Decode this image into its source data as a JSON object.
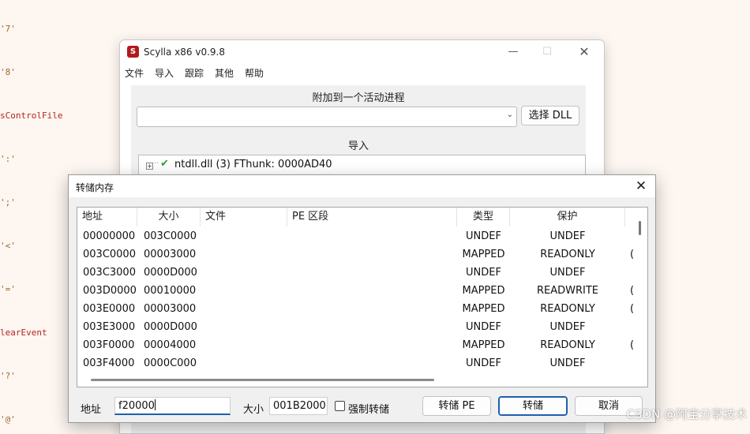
{
  "background_code": {
    "lines": [
      "'7'",
      "'8'",
      "sControlFile",
      "':'",
      "';'",
      "'<'",
      "'='",
      "learEvent",
      "'?'",
      "'@'"
    ]
  },
  "main_window": {
    "title": "Scylla x86 v0.9.8",
    "icon_letter": "S",
    "controls": {
      "minimize": "—",
      "maximize": "☐",
      "close": "✕"
    },
    "menu": [
      "文件",
      "导入",
      "跟踪",
      "其他",
      "帮助"
    ],
    "attach_group_title": "附加到一个活动进程",
    "process_combo_value": "",
    "pick_dll_label": "选择 DLL",
    "imports_group_title": "导入",
    "tree_item": {
      "expander": "+",
      "label": "ntdll.dll (3) FThunk: 0000AD40",
      "status_icon": "check-icon"
    }
  },
  "dump_dialog": {
    "title": "转储内存",
    "close_glyph": "✕",
    "columns": [
      "地址",
      "大小",
      "文件",
      "PE 区段",
      "类型",
      "保护"
    ],
    "rows": [
      {
        "address": "00000000",
        "size": "003C0000",
        "file": "",
        "pe_section": "",
        "type": "UNDEF",
        "protect": "UNDEF",
        "extra": ""
      },
      {
        "address": "003C0000",
        "size": "00003000",
        "file": "",
        "pe_section": "",
        "type": "MAPPED",
        "protect": "READONLY",
        "extra": "("
      },
      {
        "address": "003C3000",
        "size": "0000D000",
        "file": "",
        "pe_section": "",
        "type": "UNDEF",
        "protect": "UNDEF",
        "extra": ""
      },
      {
        "address": "003D0000",
        "size": "00010000",
        "file": "",
        "pe_section": "",
        "type": "MAPPED",
        "protect": "READWRITE",
        "extra": "("
      },
      {
        "address": "003E0000",
        "size": "00003000",
        "file": "",
        "pe_section": "",
        "type": "MAPPED",
        "protect": "READONLY",
        "extra": "("
      },
      {
        "address": "003E3000",
        "size": "0000D000",
        "file": "",
        "pe_section": "",
        "type": "UNDEF",
        "protect": "UNDEF",
        "extra": ""
      },
      {
        "address": "003F0000",
        "size": "00004000",
        "file": "",
        "pe_section": "",
        "type": "MAPPED",
        "protect": "READONLY",
        "extra": "("
      },
      {
        "address": "003F4000",
        "size": "0000C000",
        "file": "",
        "pe_section": "",
        "type": "UNDEF",
        "protect": "UNDEF",
        "extra": ""
      }
    ],
    "address_label": "地址",
    "address_value": "f20000",
    "size_label": "大小",
    "size_value": "001B2000",
    "force_dump_label": "强制转储",
    "force_dump_checked": false,
    "dump_pe_label": "转储 PE",
    "dump_label": "转储",
    "cancel_label": "取消"
  },
  "watermark": "CSDN @阿宝分享技术",
  "colors": {
    "accent": "#1f5fb0",
    "code_red": "#b3261e",
    "code_quote": "#9a6a2a",
    "check_green": "#2f9e2f"
  }
}
